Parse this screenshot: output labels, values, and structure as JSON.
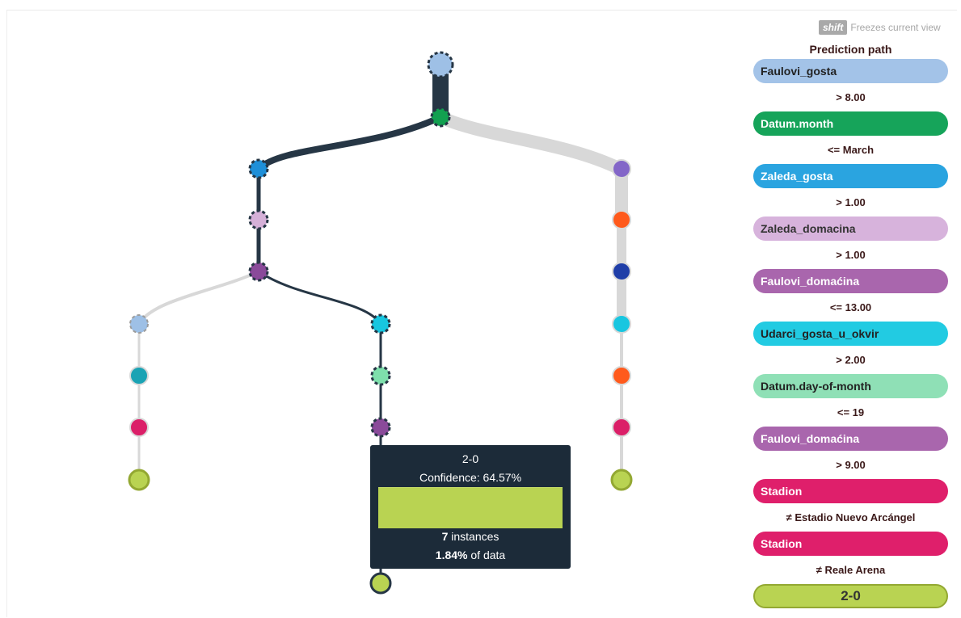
{
  "hint": {
    "key": "shift",
    "text": "Freezes current view"
  },
  "sidebar": {
    "title": "Prediction path",
    "steps": [
      {
        "label": "Faulovi_gosta",
        "color": "#a3c3e8",
        "text_color": "#222222",
        "condition": "> 8.00"
      },
      {
        "label": "Datum.month",
        "color": "#16a45a",
        "text_color": "#ffffff",
        "condition": "<= March"
      },
      {
        "label": "Zaleda_gosta",
        "color": "#2aa4e0",
        "text_color": "#ffffff",
        "condition": "> 1.00"
      },
      {
        "label": "Zaleda_domacina",
        "color": "#d7b3dc",
        "text_color": "#333333",
        "condition": "> 1.00"
      },
      {
        "label": "Faulovi_domaćina",
        "color": "#a966ad",
        "text_color": "#ffffff",
        "condition": "<= 13.00"
      },
      {
        "label": "Udarci_gosta_u_okvir",
        "color": "#22cbe2",
        "text_color": "#222222",
        "condition": "> 2.00"
      },
      {
        "label": "Datum.day-of-month",
        "color": "#8fe0b6",
        "text_color": "#222222",
        "condition": "<= 19"
      },
      {
        "label": "Faulovi_domaćina",
        "color": "#a966ad",
        "text_color": "#ffffff",
        "condition": "> 9.00"
      },
      {
        "label": "Stadion",
        "color": "#df1f6b",
        "text_color": "#ffffff",
        "condition": "≠ Estadio Nuevo Arcángel"
      },
      {
        "label": "Stadion",
        "color": "#df1f6b",
        "text_color": "#ffffff",
        "condition": "≠ Reale Arena"
      }
    ],
    "result": {
      "label": "2-0",
      "color": "#b9d352"
    }
  },
  "tooltip": {
    "class_label": "2-0",
    "confidence_label": "Confidence: 64.57%",
    "confidence": 0.6457,
    "instances_value": "7",
    "instances_suffix": " instances",
    "percent_value": "1.84%",
    "percent_suffix": " of data"
  },
  "tree": {
    "colors": {
      "Faulovi_gosta": "#9ec0e6",
      "Datum.month": "#12a050",
      "Zaleda_gosta": "#1e8fd8",
      "Zaleda_domacina": "#d5b0d8",
      "Faulovi_domacina": "#8a4a9a",
      "Udarci_gosta_u_okvir": "#18c6e0",
      "Datum.day-of-month": "#7ee0ac",
      "Stadion": "#db1f68",
      "leaf_2_0": "#b9d352",
      "purple": "#8366c8",
      "orange": "#ff5a1c",
      "navy": "#1f3ea8",
      "teal": "#1aa3b4",
      "path_edge": "#263645",
      "other_edge": "#d8d8d8"
    }
  }
}
